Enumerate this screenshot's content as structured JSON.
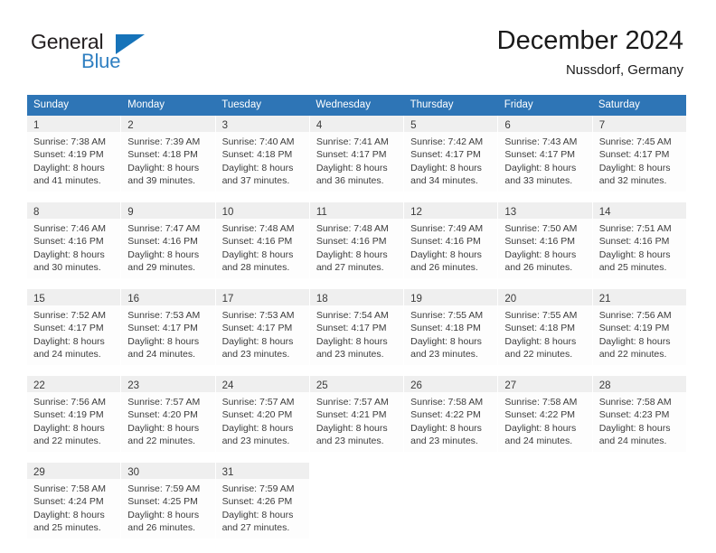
{
  "brand": {
    "name_top": "General",
    "name_bottom": "Blue",
    "triangle_color": "#1673b9",
    "blue_text_color": "#2f7fc1"
  },
  "header": {
    "title": "December 2024",
    "subtitle": "Nussdorf, Germany"
  },
  "theme": {
    "header_row_bg": "#2e75b6",
    "header_row_text": "#ffffff",
    "daynum_band_bg": "#efefef",
    "cell_bg": "#fdfdfd",
    "text_color": "#3c3c3c"
  },
  "weekdays": [
    "Sunday",
    "Monday",
    "Tuesday",
    "Wednesday",
    "Thursday",
    "Friday",
    "Saturday"
  ],
  "weeks": [
    [
      {
        "day": "1",
        "sunrise": "Sunrise: 7:38 AM",
        "sunset": "Sunset: 4:19 PM",
        "daylight1": "Daylight: 8 hours",
        "daylight2": "and 41 minutes."
      },
      {
        "day": "2",
        "sunrise": "Sunrise: 7:39 AM",
        "sunset": "Sunset: 4:18 PM",
        "daylight1": "Daylight: 8 hours",
        "daylight2": "and 39 minutes."
      },
      {
        "day": "3",
        "sunrise": "Sunrise: 7:40 AM",
        "sunset": "Sunset: 4:18 PM",
        "daylight1": "Daylight: 8 hours",
        "daylight2": "and 37 minutes."
      },
      {
        "day": "4",
        "sunrise": "Sunrise: 7:41 AM",
        "sunset": "Sunset: 4:17 PM",
        "daylight1": "Daylight: 8 hours",
        "daylight2": "and 36 minutes."
      },
      {
        "day": "5",
        "sunrise": "Sunrise: 7:42 AM",
        "sunset": "Sunset: 4:17 PM",
        "daylight1": "Daylight: 8 hours",
        "daylight2": "and 34 minutes."
      },
      {
        "day": "6",
        "sunrise": "Sunrise: 7:43 AM",
        "sunset": "Sunset: 4:17 PM",
        "daylight1": "Daylight: 8 hours",
        "daylight2": "and 33 minutes."
      },
      {
        "day": "7",
        "sunrise": "Sunrise: 7:45 AM",
        "sunset": "Sunset: 4:17 PM",
        "daylight1": "Daylight: 8 hours",
        "daylight2": "and 32 minutes."
      }
    ],
    [
      {
        "day": "8",
        "sunrise": "Sunrise: 7:46 AM",
        "sunset": "Sunset: 4:16 PM",
        "daylight1": "Daylight: 8 hours",
        "daylight2": "and 30 minutes."
      },
      {
        "day": "9",
        "sunrise": "Sunrise: 7:47 AM",
        "sunset": "Sunset: 4:16 PM",
        "daylight1": "Daylight: 8 hours",
        "daylight2": "and 29 minutes."
      },
      {
        "day": "10",
        "sunrise": "Sunrise: 7:48 AM",
        "sunset": "Sunset: 4:16 PM",
        "daylight1": "Daylight: 8 hours",
        "daylight2": "and 28 minutes."
      },
      {
        "day": "11",
        "sunrise": "Sunrise: 7:48 AM",
        "sunset": "Sunset: 4:16 PM",
        "daylight1": "Daylight: 8 hours",
        "daylight2": "and 27 minutes."
      },
      {
        "day": "12",
        "sunrise": "Sunrise: 7:49 AM",
        "sunset": "Sunset: 4:16 PM",
        "daylight1": "Daylight: 8 hours",
        "daylight2": "and 26 minutes."
      },
      {
        "day": "13",
        "sunrise": "Sunrise: 7:50 AM",
        "sunset": "Sunset: 4:16 PM",
        "daylight1": "Daylight: 8 hours",
        "daylight2": "and 26 minutes."
      },
      {
        "day": "14",
        "sunrise": "Sunrise: 7:51 AM",
        "sunset": "Sunset: 4:16 PM",
        "daylight1": "Daylight: 8 hours",
        "daylight2": "and 25 minutes."
      }
    ],
    [
      {
        "day": "15",
        "sunrise": "Sunrise: 7:52 AM",
        "sunset": "Sunset: 4:17 PM",
        "daylight1": "Daylight: 8 hours",
        "daylight2": "and 24 minutes."
      },
      {
        "day": "16",
        "sunrise": "Sunrise: 7:53 AM",
        "sunset": "Sunset: 4:17 PM",
        "daylight1": "Daylight: 8 hours",
        "daylight2": "and 24 minutes."
      },
      {
        "day": "17",
        "sunrise": "Sunrise: 7:53 AM",
        "sunset": "Sunset: 4:17 PM",
        "daylight1": "Daylight: 8 hours",
        "daylight2": "and 23 minutes."
      },
      {
        "day": "18",
        "sunrise": "Sunrise: 7:54 AM",
        "sunset": "Sunset: 4:17 PM",
        "daylight1": "Daylight: 8 hours",
        "daylight2": "and 23 minutes."
      },
      {
        "day": "19",
        "sunrise": "Sunrise: 7:55 AM",
        "sunset": "Sunset: 4:18 PM",
        "daylight1": "Daylight: 8 hours",
        "daylight2": "and 23 minutes."
      },
      {
        "day": "20",
        "sunrise": "Sunrise: 7:55 AM",
        "sunset": "Sunset: 4:18 PM",
        "daylight1": "Daylight: 8 hours",
        "daylight2": "and 22 minutes."
      },
      {
        "day": "21",
        "sunrise": "Sunrise: 7:56 AM",
        "sunset": "Sunset: 4:19 PM",
        "daylight1": "Daylight: 8 hours",
        "daylight2": "and 22 minutes."
      }
    ],
    [
      {
        "day": "22",
        "sunrise": "Sunrise: 7:56 AM",
        "sunset": "Sunset: 4:19 PM",
        "daylight1": "Daylight: 8 hours",
        "daylight2": "and 22 minutes."
      },
      {
        "day": "23",
        "sunrise": "Sunrise: 7:57 AM",
        "sunset": "Sunset: 4:20 PM",
        "daylight1": "Daylight: 8 hours",
        "daylight2": "and 22 minutes."
      },
      {
        "day": "24",
        "sunrise": "Sunrise: 7:57 AM",
        "sunset": "Sunset: 4:20 PM",
        "daylight1": "Daylight: 8 hours",
        "daylight2": "and 23 minutes."
      },
      {
        "day": "25",
        "sunrise": "Sunrise: 7:57 AM",
        "sunset": "Sunset: 4:21 PM",
        "daylight1": "Daylight: 8 hours",
        "daylight2": "and 23 minutes."
      },
      {
        "day": "26",
        "sunrise": "Sunrise: 7:58 AM",
        "sunset": "Sunset: 4:22 PM",
        "daylight1": "Daylight: 8 hours",
        "daylight2": "and 23 minutes."
      },
      {
        "day": "27",
        "sunrise": "Sunrise: 7:58 AM",
        "sunset": "Sunset: 4:22 PM",
        "daylight1": "Daylight: 8 hours",
        "daylight2": "and 24 minutes."
      },
      {
        "day": "28",
        "sunrise": "Sunrise: 7:58 AM",
        "sunset": "Sunset: 4:23 PM",
        "daylight1": "Daylight: 8 hours",
        "daylight2": "and 24 minutes."
      }
    ],
    [
      {
        "day": "29",
        "sunrise": "Sunrise: 7:58 AM",
        "sunset": "Sunset: 4:24 PM",
        "daylight1": "Daylight: 8 hours",
        "daylight2": "and 25 minutes."
      },
      {
        "day": "30",
        "sunrise": "Sunrise: 7:59 AM",
        "sunset": "Sunset: 4:25 PM",
        "daylight1": "Daylight: 8 hours",
        "daylight2": "and 26 minutes."
      },
      {
        "day": "31",
        "sunrise": "Sunrise: 7:59 AM",
        "sunset": "Sunset: 4:26 PM",
        "daylight1": "Daylight: 8 hours",
        "daylight2": "and 27 minutes."
      },
      {
        "day": "",
        "sunrise": "",
        "sunset": "",
        "daylight1": "",
        "daylight2": ""
      },
      {
        "day": "",
        "sunrise": "",
        "sunset": "",
        "daylight1": "",
        "daylight2": ""
      },
      {
        "day": "",
        "sunrise": "",
        "sunset": "",
        "daylight1": "",
        "daylight2": ""
      },
      {
        "day": "",
        "sunrise": "",
        "sunset": "",
        "daylight1": "",
        "daylight2": ""
      }
    ]
  ]
}
